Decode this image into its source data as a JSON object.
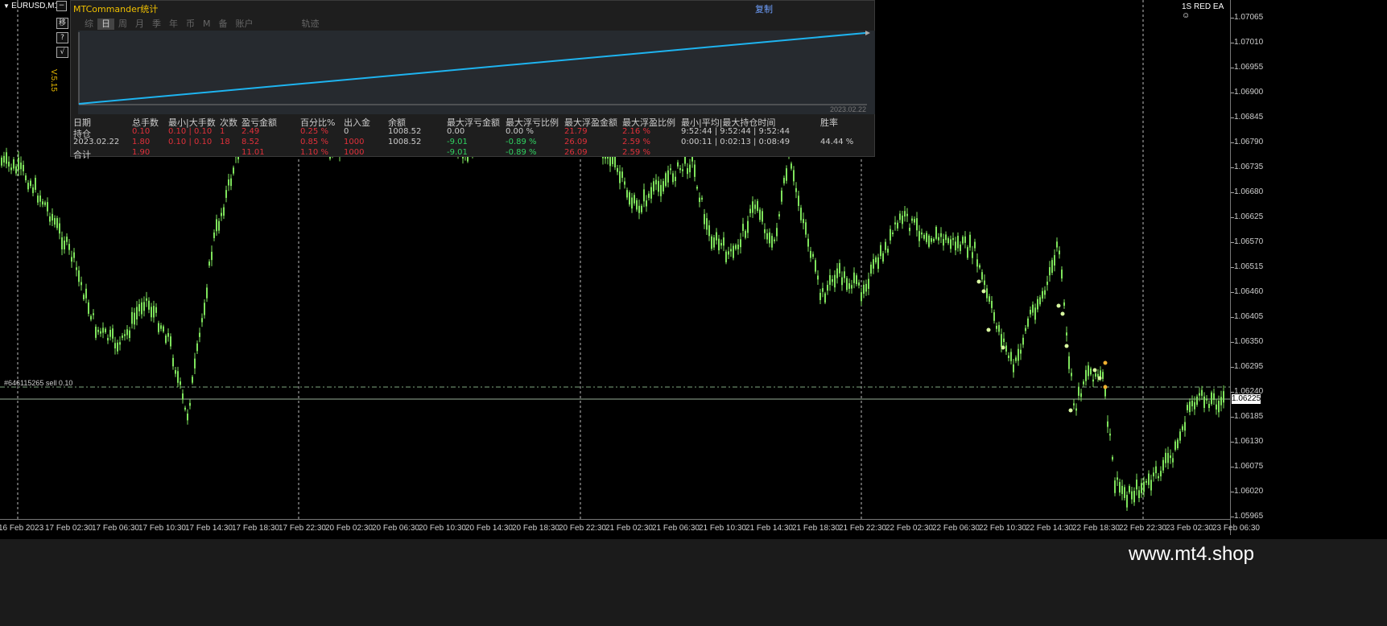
{
  "chart": {
    "symbol": "EURUSD,M15",
    "ea_label": "1S RED EA",
    "smile_icon": "smiley-icon",
    "order_line_label": "#646115265 sell 0.10",
    "current_price": "1.06225",
    "price_levels": [
      "1.07065",
      "1.07010",
      "1.06955",
      "1.06900",
      "1.06845",
      "1.06790",
      "1.06735",
      "1.06680",
      "1.06625",
      "1.06570",
      "1.06515",
      "1.06460",
      "1.06405",
      "1.06350",
      "1.06295",
      "1.06240",
      "1.06185",
      "1.06130",
      "1.06075",
      "1.06020",
      "1.05965"
    ],
    "time_labels": [
      "16 Feb 2023",
      "17 Feb 02:30",
      "17 Feb 06:30",
      "17 Feb 10:30",
      "17 Feb 14:30",
      "17 Feb 18:30",
      "17 Feb 22:30",
      "20 Feb 02:30",
      "20 Feb 06:30",
      "20 Feb 10:30",
      "20 Feb 14:30",
      "20 Feb 18:30",
      "20 Feb 22:30",
      "21 Feb 02:30",
      "21 Feb 06:30",
      "21 Feb 10:30",
      "21 Feb 14:30",
      "21 Feb 18:30",
      "21 Feb 22:30",
      "22 Feb 02:30",
      "22 Feb 06:30",
      "22 Feb 10:30",
      "22 Feb 14:30",
      "22 Feb 18:30",
      "22 Feb 22:30",
      "23 Feb 02:30",
      "23 Feb 06:30"
    ],
    "minimize_label": "−",
    "side_buttons": [
      "移",
      "?",
      "√"
    ],
    "version_label": "V.5.15",
    "candle_color": "#7ee35c",
    "order_line_color": "#7fa67f"
  },
  "panel": {
    "title": "MTCommander统计",
    "copy_label": "复制",
    "tabs": [
      "综",
      "日",
      "周",
      "月",
      "季",
      "年",
      "币",
      "M",
      "备",
      "账户",
      "轨迹"
    ],
    "active_tab": "日",
    "chart_date": "2023.02.22",
    "headers": [
      "日期",
      "总手数",
      "最小|大手数",
      "次数",
      "盈亏金额",
      "百分比%",
      "出入金",
      "余额",
      "最大浮亏金额",
      "最大浮亏比例",
      "最大浮盈金额",
      "最大浮盈比例",
      "最小|平均|最大持仓时间",
      "胜率"
    ],
    "rows": [
      [
        "持仓",
        "0.10",
        "0.10 | 0.10",
        "1",
        "2.49",
        "0.25 %",
        "0",
        "1008.52",
        "0.00",
        "0.00 %",
        "21.79",
        "2.16 %",
        "9:52:44 | 9:52:44 | 9:52:44",
        ""
      ],
      [
        "2023.02.22",
        "1.80",
        "0.10 | 0.10",
        "18",
        "8.52",
        "0.85 %",
        "1000",
        "1008.52",
        "-9.01",
        "-0.89 %",
        "26.09",
        "2.59 %",
        "0:00:11 | 0:02:13 | 0:08:49",
        "44.44 %"
      ],
      [
        "合计",
        "1.90",
        "",
        "",
        "11.01",
        "1.10 %",
        "1000",
        "",
        "-9.01",
        "-0.89 %",
        "26.09",
        "2.59 %",
        "",
        ""
      ]
    ],
    "line_color": "#1eb4f0"
  },
  "watermark": "www.mt4.shop"
}
